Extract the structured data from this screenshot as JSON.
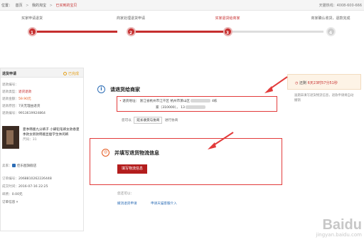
{
  "breadcrumb": {
    "lead": "位置：",
    "home": "首页",
    "mine": "我的淘宝",
    "current": "已买到的宝贝",
    "sep": ">",
    "hotline": "天猫热线：4008-600-666"
  },
  "steps": [
    {
      "label": "买家申请退货",
      "num": "1",
      "state": "done"
    },
    {
      "label": "商家处理退货申请",
      "num": "2",
      "state": "done"
    },
    {
      "label": "买家退货给商家",
      "num": "3",
      "state": "active"
    },
    {
      "label": "商家确认收货，退款完成",
      "num": "4",
      "state": "todo"
    }
  ],
  "sidebar": {
    "title": "退货申请",
    "done_label": "已完成",
    "rows": [
      {
        "label": "退款编号：",
        "value": "",
        "tone": ""
      },
      {
        "label": "退款类型：",
        "value": "退货退款",
        "tone": "red"
      },
      {
        "label": "退款金额：",
        "value": "59.90元",
        "tone": "orange"
      },
      {
        "label": "退款原因：",
        "value": "7天无理由退货",
        "tone": ""
      },
      {
        "label": "退款编号：",
        "value": "9913619924864",
        "tone": ""
      }
    ],
    "product_title": "夏季韩版九分裤子 小脚铅笔裤女款春夏季款女新款韩版显瘦学生休闲裤",
    "sku": "尺码：31",
    "seller_label": "卖家：",
    "seller_link": "佳乐图旗舰店",
    "order_no_label": "订单编号：",
    "order_no": "2068810262226448",
    "time_label": "成交时间：",
    "time": "2016-07-16 22:25",
    "postage_label": "邮费：",
    "postage": "0.00元",
    "more": "订单信息"
  },
  "main": {
    "step_title": "请退货给商家",
    "address_label": "退货地址：",
    "address_line1": "浙江省杭州市江干区 杭州市萧山区",
    "address_line1_end": "4栋",
    "address_line2_pre": "家（310000）， 13",
    "opts_pre": "您可以",
    "opts_btn": "延长收货与协商",
    "opts_post": "进行协商",
    "ship_title": "并填写退货物流信息",
    "fill_button": "填写物流信息",
    "foot_text": "您还可以：",
    "foot_link1": "撤消退货申请",
    "foot_link2": "申请天猫客服介入"
  },
  "timer": {
    "label": "还剩",
    "value": "6天23时57分51秒"
  },
  "note": "逾期未填写退货物流信息，退款申请将自动撤销",
  "watermark": {
    "big": "Baidu",
    "small": "jingyan.baidu.com"
  }
}
